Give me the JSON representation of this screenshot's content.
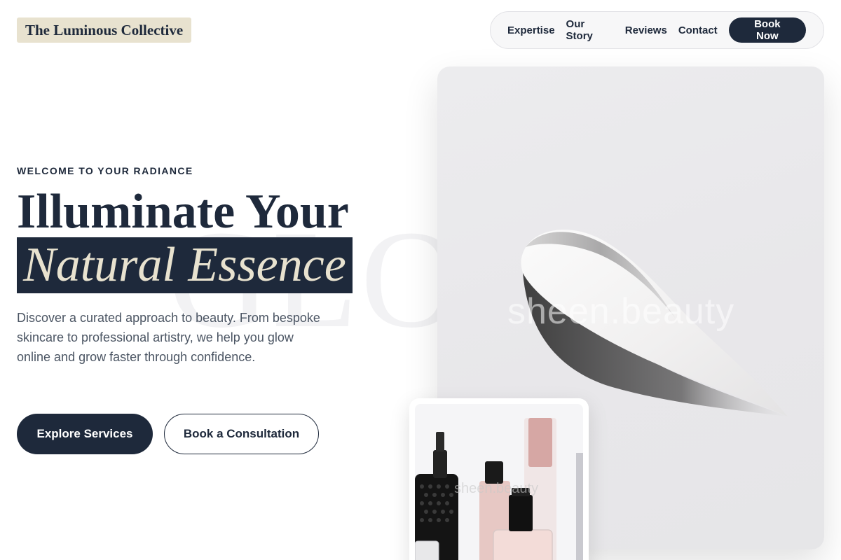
{
  "header": {
    "logo": "The Luminous Collective",
    "nav": [
      "Expertise",
      "Our Story",
      "Reviews",
      "Contact"
    ],
    "cta": "Book Now"
  },
  "hero": {
    "watermark": "GLO",
    "eyebrow": "WELCOME TO YOUR RADIANCE",
    "headline_line1": "Illuminate Your",
    "headline_line2": "Natural Essence",
    "description": "Discover a curated approach to beauty. From bespoke skincare to professional artistry, we help you glow online and grow faster through confidence.",
    "primary_button": "Explore Services",
    "secondary_button": "Book a Consultation"
  },
  "images": {
    "main_watermark": "sheen.beauty",
    "product_watermark": "sheen.beauty"
  },
  "colors": {
    "navy": "#1e293b",
    "beige": "#e8e2cf",
    "text_muted": "#4b5563"
  }
}
